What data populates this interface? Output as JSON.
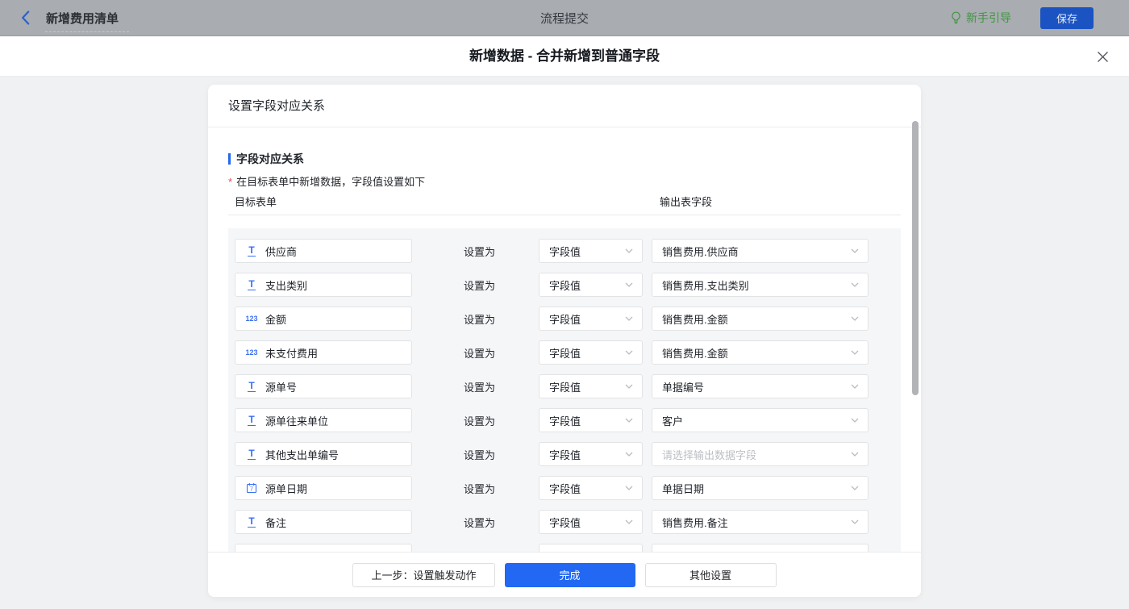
{
  "topbar": {
    "back_title": "新增费用清单",
    "center_title": "流程提交",
    "guide_label": "新手引导",
    "save_label": "保存"
  },
  "modal": {
    "title": "新增数据 - 合并新增到普通字段"
  },
  "card": {
    "header": "设置字段对应关系",
    "section_title": "字段对应关系",
    "note": "在目标表单中新增数据，字段值设置如下",
    "note_asterisk": "*",
    "col_left": "目标表单",
    "col_right": "输出表字段",
    "relation_label": "设置为"
  },
  "rows": [
    {
      "icon": "text-field-icon",
      "field": "供应商",
      "mode": "字段值",
      "output": "销售费用.供应商",
      "output_placeholder": false
    },
    {
      "icon": "text-field-icon",
      "field": "支出类别",
      "mode": "字段值",
      "output": "销售费用.支出类别",
      "output_placeholder": false
    },
    {
      "icon": "number-field-icon",
      "field": "金额",
      "mode": "字段值",
      "output": "销售费用.金额",
      "output_placeholder": false
    },
    {
      "icon": "number-field-icon",
      "field": "未支付费用",
      "mode": "字段值",
      "output": "销售费用.金额",
      "output_placeholder": false
    },
    {
      "icon": "text-field-icon",
      "field": "源单号",
      "mode": "字段值",
      "output": "单据编号",
      "output_placeholder": false
    },
    {
      "icon": "text-field-icon",
      "field": "源单往来单位",
      "mode": "字段值",
      "output": "客户",
      "output_placeholder": false
    },
    {
      "icon": "text-field-icon",
      "field": "其他支出单编号",
      "mode": "字段值",
      "output": "请选择输出数据字段",
      "output_placeholder": true
    },
    {
      "icon": "date-field-icon",
      "field": "源单日期",
      "mode": "字段值",
      "output": "单据日期",
      "output_placeholder": false
    },
    {
      "icon": "text-field-icon",
      "field": "备注",
      "mode": "字段值",
      "output": "销售费用.备注",
      "output_placeholder": false
    }
  ],
  "partial_row": {
    "visible": true
  },
  "footer": {
    "prev_label": "上一步：设置触发动作",
    "done_label": "完成",
    "other_label": "其他设置"
  },
  "colors": {
    "accent_blue": "#2268f2",
    "field_icon_blue": "#3a6ff2",
    "guide_green": "#3f9643",
    "save_button_bg": "#1b54c2",
    "topbar_dimmed_bg": "#a9acb0",
    "placeholder_gray": "#bcbfc4"
  }
}
